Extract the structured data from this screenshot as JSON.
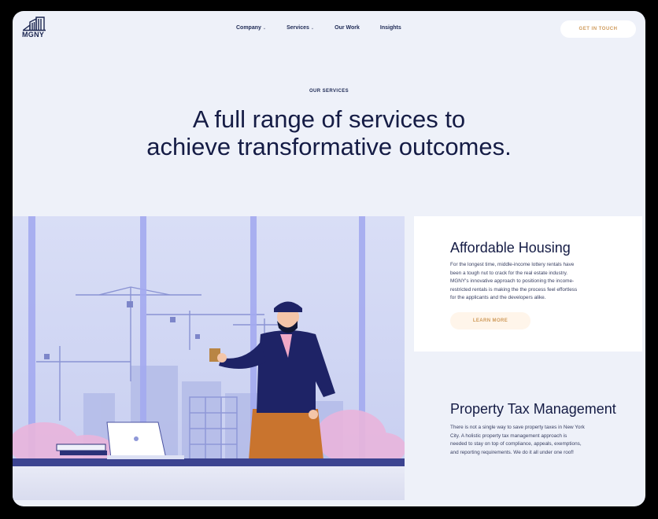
{
  "brand": {
    "name": "MGNY"
  },
  "nav": {
    "items": [
      {
        "label": "Company",
        "has_dropdown": true
      },
      {
        "label": "Services",
        "has_dropdown": true
      },
      {
        "label": "Our Work",
        "has_dropdown": false
      },
      {
        "label": "Insights",
        "has_dropdown": false
      }
    ],
    "cta_label": "GET IN TOUCH"
  },
  "hero": {
    "eyebrow": "OUR SERVICES",
    "headline_line1": "A full range of services to",
    "headline_line2": "achieve transformative outcomes."
  },
  "services": [
    {
      "title": "Affordable Housing",
      "body_lines": [
        "For the longest time, middle-income lottery rentals have",
        "been a tough nut to crack for the real estate industry.",
        "MGNY's innovative approach to positioning the income-",
        "restricted rentals is making the the process feel effortless",
        "for the applicants and the developers alike."
      ],
      "button_label": "LEARN MORE"
    },
    {
      "title": "Property Tax Management",
      "body_lines": [
        "There is not a single way to save property taxes in New York",
        "City. A holistic property tax management approach is",
        "needed to stay on top of compliance, appeals, exemptions,",
        "and reporting requirements. We do it all under one roof!"
      ]
    }
  ],
  "colors": {
    "page_bg": "#eef1f9",
    "navy": "#151c45",
    "accent": "#cf9a5a",
    "card_bg": "#ffffff"
  }
}
